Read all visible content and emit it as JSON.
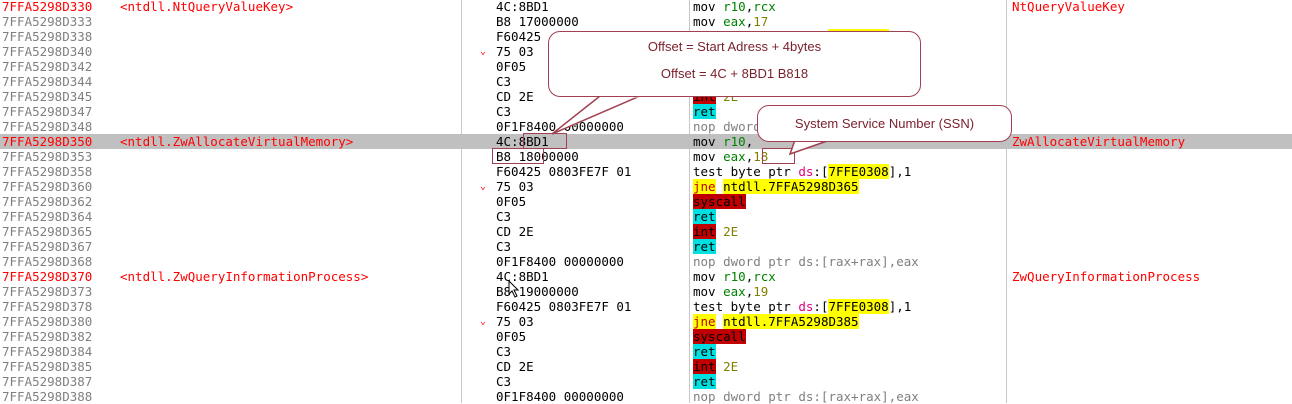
{
  "rows": [
    {
      "addr": "7FFA5298D330",
      "red": true,
      "label": "<ntdll.NtQueryValueKey>",
      "arrow": "",
      "bytes": "4C:8BD1",
      "dis": [
        {
          "t": "mov "
        },
        {
          "t": "r10",
          "c": "reg"
        },
        {
          "t": ","
        },
        {
          "t": "rcx",
          "c": "reg"
        }
      ],
      "cmt": "NtQueryValueKey"
    },
    {
      "addr": "7FFA5298D333",
      "red": false,
      "label": "",
      "arrow": "",
      "bytes": "B8 17000000",
      "dis": [
        {
          "t": "mov "
        },
        {
          "t": "eax",
          "c": "reg"
        },
        {
          "t": ","
        },
        {
          "t": "17",
          "c": "num"
        }
      ],
      "cmt": ""
    },
    {
      "addr": "7FFA5298D338",
      "red": false,
      "label": "",
      "arrow": "",
      "bytes": "F60425",
      "dis": [
        {
          "t": "test byte ptr "
        },
        {
          "t": "ds",
          "c": "ds"
        },
        {
          "t": ":["
        },
        {
          "t": "7FFE0308",
          "c": "hl-y"
        },
        {
          "t": "],1"
        }
      ],
      "cmt": ""
    },
    {
      "addr": "7FFA5298D340",
      "red": false,
      "label": "",
      "arrow": "⌄",
      "bytes": "75 03",
      "dis": [],
      "cmt": ""
    },
    {
      "addr": "7FFA5298D342",
      "red": false,
      "label": "",
      "arrow": "",
      "bytes": "0F05",
      "dis": [],
      "cmt": ""
    },
    {
      "addr": "7FFA5298D344",
      "red": false,
      "label": "",
      "arrow": "",
      "bytes": "C3",
      "dis": [],
      "cmt": ""
    },
    {
      "addr": "7FFA5298D345",
      "red": false,
      "label": "",
      "arrow": "",
      "bytes": "CD 2E",
      "dis": [
        {
          "t": "int",
          "c": "hl-red"
        },
        {
          "t": " "
        },
        {
          "t": "2E",
          "c": "num"
        }
      ],
      "cmt": ""
    },
    {
      "addr": "7FFA5298D347",
      "red": false,
      "label": "",
      "arrow": "",
      "bytes": "C3",
      "dis": [
        {
          "t": "ret",
          "c": "hl-cyan"
        }
      ],
      "cmt": ""
    },
    {
      "addr": "7FFA5298D348",
      "red": false,
      "label": "",
      "arrow": "",
      "bytes": "0F1F8400 00000000",
      "dis": [
        {
          "t": "nop dword",
          "c": "nop"
        }
      ],
      "cmt": ""
    },
    {
      "addr": "7FFA5298D350",
      "red": true,
      "label": "<ntdll.ZwAllocateVirtualMemory>",
      "arrow": "",
      "bytes": "4C:8BD1",
      "dis": [
        {
          "t": "mov "
        },
        {
          "t": "r10",
          "c": "reg"
        },
        {
          "t": ","
        }
      ],
      "cmt": "ZwAllocateVirtualMemory",
      "sel": true
    },
    {
      "addr": "7FFA5298D353",
      "red": false,
      "label": "",
      "arrow": "",
      "bytes": "B8 18000000",
      "dis": [
        {
          "t": "mov "
        },
        {
          "t": "eax",
          "c": "reg"
        },
        {
          "t": ","
        },
        {
          "t": "18",
          "c": "num"
        }
      ],
      "cmt": ""
    },
    {
      "addr": "7FFA5298D358",
      "red": false,
      "label": "",
      "arrow": "",
      "bytes": "F60425 0803FE7F 01",
      "dis": [
        {
          "t": "test byte ptr "
        },
        {
          "t": "ds",
          "c": "ds"
        },
        {
          "t": ":["
        },
        {
          "t": "7FFE0308",
          "c": "hl-y"
        },
        {
          "t": "],1"
        }
      ],
      "cmt": ""
    },
    {
      "addr": "7FFA5298D360",
      "red": false,
      "label": "",
      "arrow": "⌄",
      "bytes": "75 03",
      "dis": [
        {
          "t": "jne",
          "c": "hl-y kw-red"
        },
        {
          "t": " "
        },
        {
          "t": "ntdll.7FFA5298D365",
          "c": "hl-y"
        }
      ],
      "cmt": ""
    },
    {
      "addr": "7FFA5298D362",
      "red": false,
      "label": "",
      "arrow": "",
      "bytes": "0F05",
      "dis": [
        {
          "t": "syscall",
          "c": "hl-red"
        }
      ],
      "cmt": ""
    },
    {
      "addr": "7FFA5298D364",
      "red": false,
      "label": "",
      "arrow": "",
      "bytes": "C3",
      "dis": [
        {
          "t": "ret",
          "c": "hl-cyan"
        }
      ],
      "cmt": ""
    },
    {
      "addr": "7FFA5298D365",
      "red": false,
      "label": "",
      "arrow": "",
      "bytes": "CD 2E",
      "dis": [
        {
          "t": "int",
          "c": "hl-red"
        },
        {
          "t": " "
        },
        {
          "t": "2E",
          "c": "num"
        }
      ],
      "cmt": ""
    },
    {
      "addr": "7FFA5298D367",
      "red": false,
      "label": "",
      "arrow": "",
      "bytes": "C3",
      "dis": [
        {
          "t": "ret",
          "c": "hl-cyan"
        }
      ],
      "cmt": ""
    },
    {
      "addr": "7FFA5298D368",
      "red": false,
      "label": "",
      "arrow": "",
      "bytes": "0F1F8400 00000000",
      "dis": [
        {
          "t": "nop dword ptr ds:[rax+rax],eax",
          "c": "nop"
        }
      ],
      "cmt": ""
    },
    {
      "addr": "7FFA5298D370",
      "red": true,
      "label": "<ntdll.ZwQueryInformationProcess>",
      "arrow": "",
      "bytes": "4C:8BD1",
      "dis": [
        {
          "t": "mov "
        },
        {
          "t": "r10",
          "c": "reg"
        },
        {
          "t": ","
        },
        {
          "t": "rcx",
          "c": "reg"
        }
      ],
      "cmt": "ZwQueryInformationProcess"
    },
    {
      "addr": "7FFA5298D373",
      "red": false,
      "label": "",
      "arrow": "",
      "bytes": "B8 19000000",
      "dis": [
        {
          "t": "mov "
        },
        {
          "t": "eax",
          "c": "reg"
        },
        {
          "t": ","
        },
        {
          "t": "19",
          "c": "num"
        }
      ],
      "cmt": ""
    },
    {
      "addr": "7FFA5298D378",
      "red": false,
      "label": "",
      "arrow": "",
      "bytes": "F60425 0803FE7F 01",
      "dis": [
        {
          "t": "test byte ptr "
        },
        {
          "t": "ds",
          "c": "ds"
        },
        {
          "t": ":["
        },
        {
          "t": "7FFE0308",
          "c": "hl-y"
        },
        {
          "t": "],1"
        }
      ],
      "cmt": ""
    },
    {
      "addr": "7FFA5298D380",
      "red": false,
      "label": "",
      "arrow": "⌄",
      "bytes": "75 03",
      "dis": [
        {
          "t": "jne",
          "c": "hl-y kw-red"
        },
        {
          "t": " "
        },
        {
          "t": "ntdll.7FFA5298D385",
          "c": "hl-y"
        }
      ],
      "cmt": ""
    },
    {
      "addr": "7FFA5298D382",
      "red": false,
      "label": "",
      "arrow": "",
      "bytes": "0F05",
      "dis": [
        {
          "t": "syscall",
          "c": "hl-red"
        }
      ],
      "cmt": ""
    },
    {
      "addr": "7FFA5298D384",
      "red": false,
      "label": "",
      "arrow": "",
      "bytes": "C3",
      "dis": [
        {
          "t": "ret",
          "c": "hl-cyan"
        }
      ],
      "cmt": ""
    },
    {
      "addr": "7FFA5298D385",
      "red": false,
      "label": "",
      "arrow": "",
      "bytes": "CD 2E",
      "dis": [
        {
          "t": "int",
          "c": "hl-red"
        },
        {
          "t": " "
        },
        {
          "t": "2E",
          "c": "num"
        }
      ],
      "cmt": ""
    },
    {
      "addr": "7FFA5298D387",
      "red": false,
      "label": "",
      "arrow": "",
      "bytes": "C3",
      "dis": [
        {
          "t": "ret",
          "c": "hl-cyan"
        }
      ],
      "cmt": ""
    },
    {
      "addr": "7FFA5298D388",
      "red": false,
      "label": "",
      "arrow": "",
      "bytes": "0F1F8400 00000000",
      "dis": [
        {
          "t": "nop dword ptr ds:[rax+rax],eax",
          "c": "nop"
        }
      ],
      "cmt": ""
    }
  ],
  "callouts": {
    "offset_line1": "Offset = Start Adress + 4bytes",
    "offset_line2": "Offset = 4C + 8BD1 B818",
    "ssn": "System Service Number (SSN)"
  },
  "colors": {
    "address_red": "#ff0000",
    "register": "#008000",
    "immediate": "#808000",
    "highlight_yellow": "#ffff00",
    "highlight_red": "#c00000",
    "highlight_cyan": "#00e0e0",
    "selected_row": "#c0c0c0",
    "callout_border": "#a04050"
  }
}
